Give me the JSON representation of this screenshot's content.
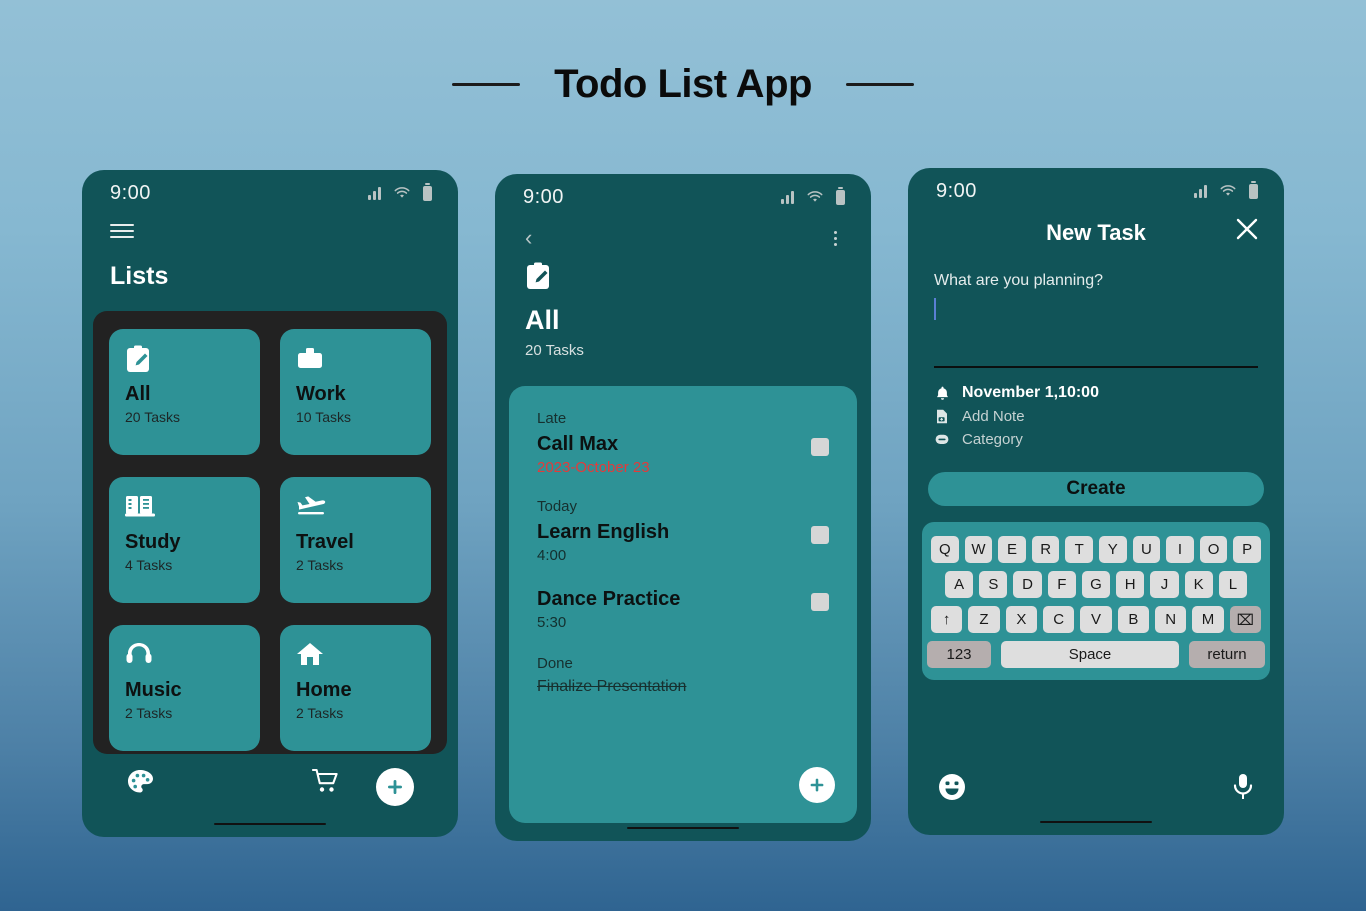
{
  "page": {
    "title": "Todo List App"
  },
  "phone1": {
    "status": {
      "time": "9:00",
      "signal_icon": "signal-bars-icon",
      "wifi_icon": "wifi-icon",
      "battery_icon": "battery-icon"
    },
    "menu_icon": "hamburger-menu-icon",
    "heading": "Lists",
    "cards": [
      {
        "icon": "clipboard-pencil-icon",
        "name": "All",
        "count": "20 Tasks"
      },
      {
        "icon": "briefcase-icon",
        "name": "Work",
        "count": "10 Tasks"
      },
      {
        "icon": "books-icon",
        "name": "Study",
        "count": "4 Tasks"
      },
      {
        "icon": "airplane-icon",
        "name": "Travel",
        "count": "2 Tasks"
      },
      {
        "icon": "headphones-icon",
        "name": "Music",
        "count": "2 Tasks"
      },
      {
        "icon": "home-icon",
        "name": "Home",
        "count": "2 Tasks"
      }
    ],
    "bottom_bar": {
      "palette_icon": "palette-icon",
      "cart_icon": "shopping-cart-icon",
      "add_icon": "plus-circle-icon"
    }
  },
  "phone2": {
    "status": {
      "time": "9:00"
    },
    "back_icon": "chevron-left-icon",
    "menu_icon": "kebab-menu-icon",
    "list_icon": "clipboard-pencil-icon",
    "title": "All",
    "subtitle": "20 Tasks",
    "groups": [
      {
        "label": "Late",
        "tasks": [
          {
            "title": "Call Max",
            "meta": "2023-October 23",
            "meta_style": "late",
            "done": false
          }
        ]
      },
      {
        "label": "Today",
        "tasks": [
          {
            "title": "Learn English",
            "meta": "4:00",
            "meta_style": "normal",
            "done": false
          },
          {
            "title": "Dance Practice",
            "meta": "5:30",
            "meta_style": "normal",
            "done": false
          }
        ]
      },
      {
        "label": "Done",
        "tasks": [
          {
            "title": "Finalize Presentation",
            "meta": "",
            "meta_style": "normal",
            "done": true
          }
        ]
      }
    ],
    "fab_icon": "plus-circle-icon"
  },
  "phone3": {
    "status": {
      "time": "9:00"
    },
    "title": "New Task",
    "close_icon": "close-x-icon",
    "prompt": "What are you planning?",
    "input_value": "",
    "options": [
      {
        "icon": "bell-icon",
        "label": "November 1,10:00",
        "emphasis": true
      },
      {
        "icon": "note-add-icon",
        "label": "Add Note",
        "emphasis": false
      },
      {
        "icon": "tag-icon",
        "label": "Category",
        "emphasis": false
      }
    ],
    "create_label": "Create",
    "keyboard": {
      "row1": [
        "Q",
        "W",
        "E",
        "R",
        "T",
        "Y",
        "U",
        "I",
        "O",
        "P"
      ],
      "row2": [
        "A",
        "S",
        "D",
        "F",
        "G",
        "H",
        "J",
        "K",
        "L"
      ],
      "row3": [
        "Z",
        "X",
        "C",
        "V",
        "B",
        "N",
        "M"
      ],
      "shift_key": "↑",
      "backspace_key": "⌧",
      "num_key": "123",
      "space_key": "Space",
      "return_key": "return"
    },
    "bottom_bar": {
      "emoji_icon": "emoji-face-icon",
      "mic_icon": "microphone-icon"
    }
  },
  "colors": {
    "phone_bg": "#115458",
    "accent_teal": "#2e9296",
    "panel_dark": "#222222",
    "late_red": "#e23b3b",
    "bg_top": "#93c0d6",
    "bg_bottom": "#2f6491"
  }
}
